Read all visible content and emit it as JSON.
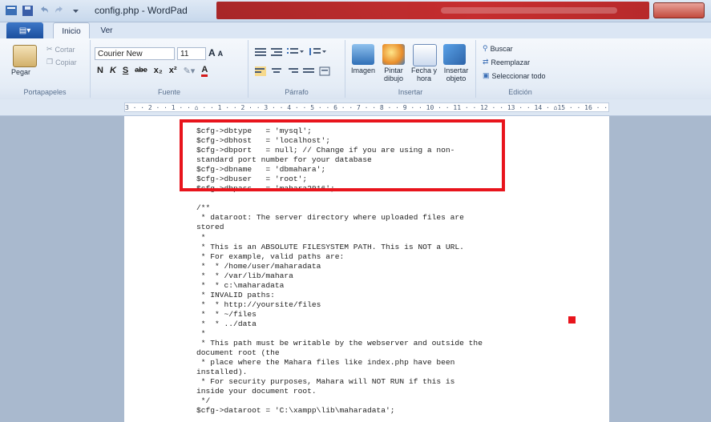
{
  "window": {
    "title": "config.php - WordPad"
  },
  "tabs": {
    "file_label": "▤▾",
    "home": "Inicio",
    "view": "Ver"
  },
  "ribbon": {
    "clipboard": {
      "paste": "Pegar",
      "cut": "Cortar",
      "copy": "Copiar",
      "label": "Portapapeles"
    },
    "font": {
      "family": "Courier New",
      "size": "11",
      "grow": "A",
      "shrink": "A",
      "bold": "N",
      "italic": "K",
      "underline": "S",
      "strike": "abe",
      "sub": "x₂",
      "sup": "x²",
      "label": "Fuente"
    },
    "paragraph": {
      "label": "Párrafo"
    },
    "insert": {
      "image": "Imagen",
      "paint": "Pintar dibujo",
      "datetime": "Fecha y hora",
      "object": "Insertar objeto",
      "label": "Insertar"
    },
    "edit": {
      "find": "Buscar",
      "replace": "Reemplazar",
      "select_all": "Seleccionar todo",
      "label": "Edición"
    }
  },
  "ruler": {
    "text": "3 · · 2 · · 1 · · ⌂ · · 1 · · 2 · · 3 · · 4 · · 5 · · 6 · · 7 · · 8 · · 9 · · 10 · · 11 · · 12 · · 13 · · 14 · ⌂15 · · 16 · · 17 · ·"
  },
  "document": {
    "text": "$cfg->dbtype   = 'mysql';\n$cfg->dbhost   = 'localhost';\n$cfg->dbport   = null; // Change if you are using a non-\nstandard port number for your database\n$cfg->dbname   = 'dbmahara';\n$cfg->dbuser   = 'root';\n$cfg->dbpass   = 'mahara2016';\n\n/**\n * dataroot: The server directory where uploaded files are\nstored\n *\n * This is an ABSOLUTE FILESYSTEM PATH. This is NOT a URL.\n * For example, valid paths are:\n *  * /home/user/maharadata\n *  * /var/lib/mahara\n *  * c:\\maharadata\n * INVALID paths:\n *  * http://yoursite/files\n *  * ~/files\n *  * ../data\n *\n * This path must be writable by the webserver and outside the\ndocument root (the\n * place where the Mahara files like index.php have been\ninstalled).\n * For security purposes, Mahara will NOT RUN if this is\ninside your document root.\n */\n$cfg->dataroot = 'C:\\xampp\\lib\\maharadata';"
  },
  "colors": {
    "highlight": "#e8141c",
    "ribbon": "#e4ecf6",
    "doc_bg": "#a9b9ce"
  }
}
